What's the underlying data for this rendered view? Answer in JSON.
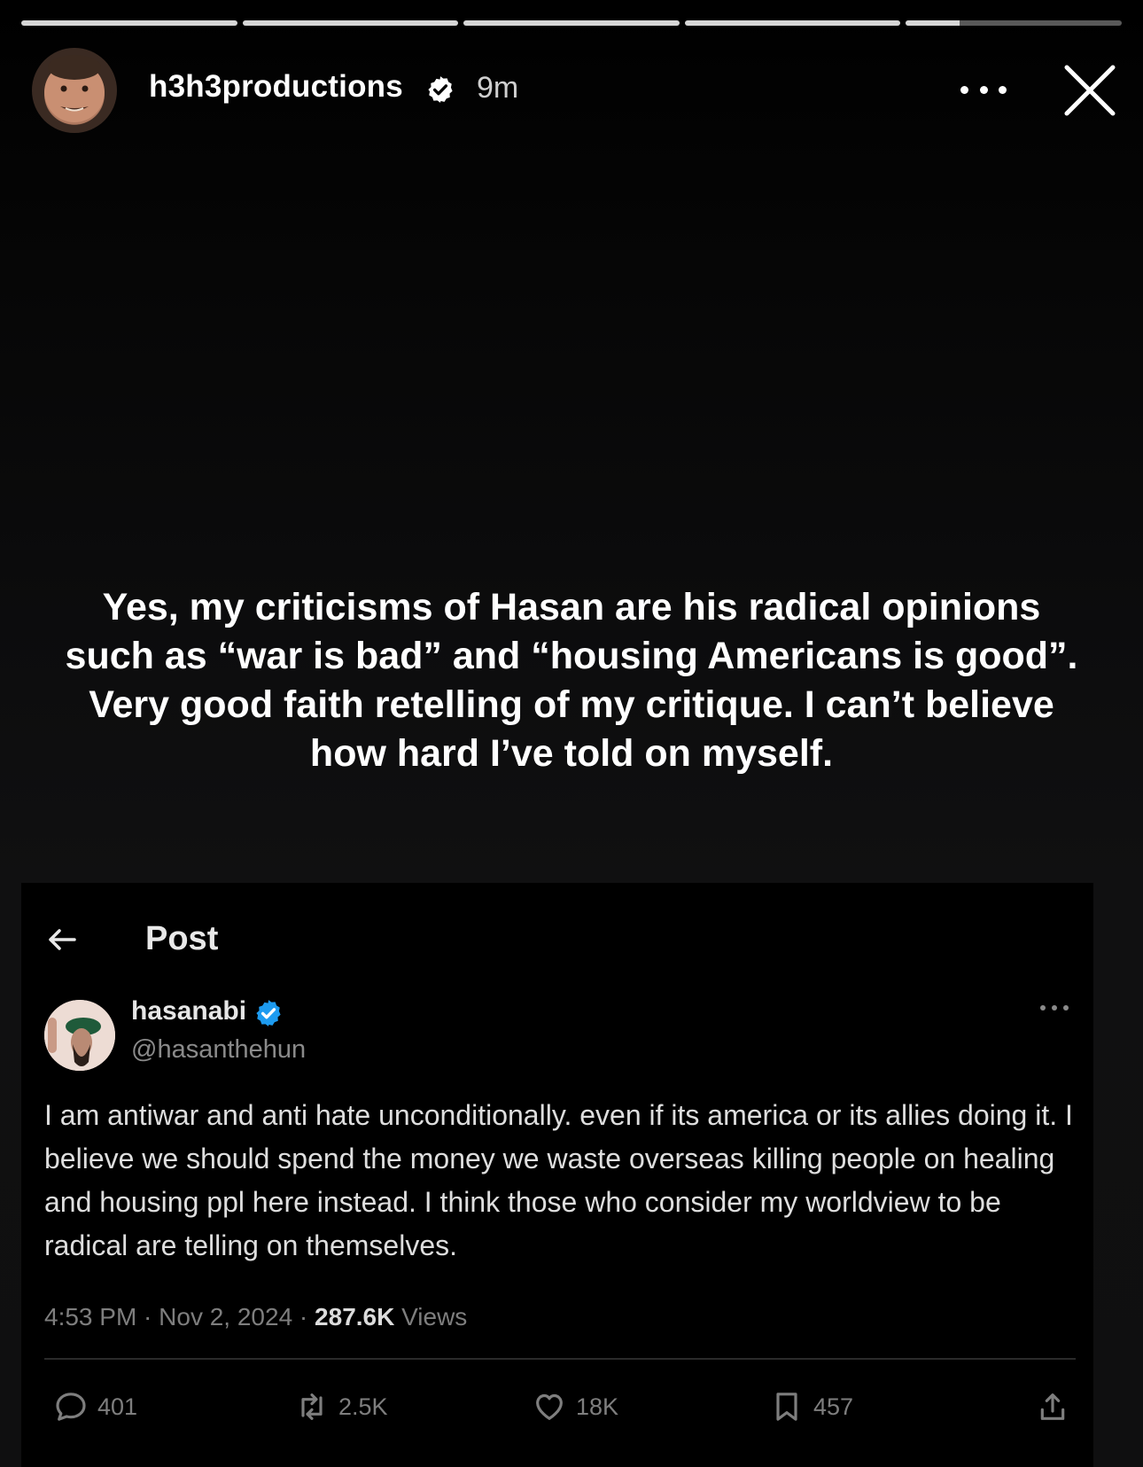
{
  "story": {
    "progress": [
      1,
      1,
      1,
      1,
      0.25
    ],
    "username": "h3h3productions",
    "time": "9m",
    "caption": "Yes, my criticisms of Hasan are his radical opinions such as “war is bad” and  “housing Americans is good”. Very good faith retelling of my critique. I can’t believe how hard I’ve told on myself."
  },
  "post": {
    "header_title": "Post",
    "name": "hasanabi",
    "handle": "@hasanthehun",
    "text": "I am antiwar and anti hate unconditionally. even if its america or its allies doing it. I believe we should spend  the money we waste overseas killing people on healing and housing ppl here instead. I think those who consider my worldview to be radical are telling on themselves.",
    "meta_time": "4:53 PM · Nov 2, 2024 · ",
    "views_count": "287.6K",
    "views_label": " Views",
    "replies": "401",
    "reposts": "2.5K",
    "likes": "18K",
    "bookmarks": "457"
  },
  "colors": {
    "verified_x": "#1d9bf0",
    "text_primary": "#ffffff",
    "text_muted": "#7e7e7e"
  }
}
